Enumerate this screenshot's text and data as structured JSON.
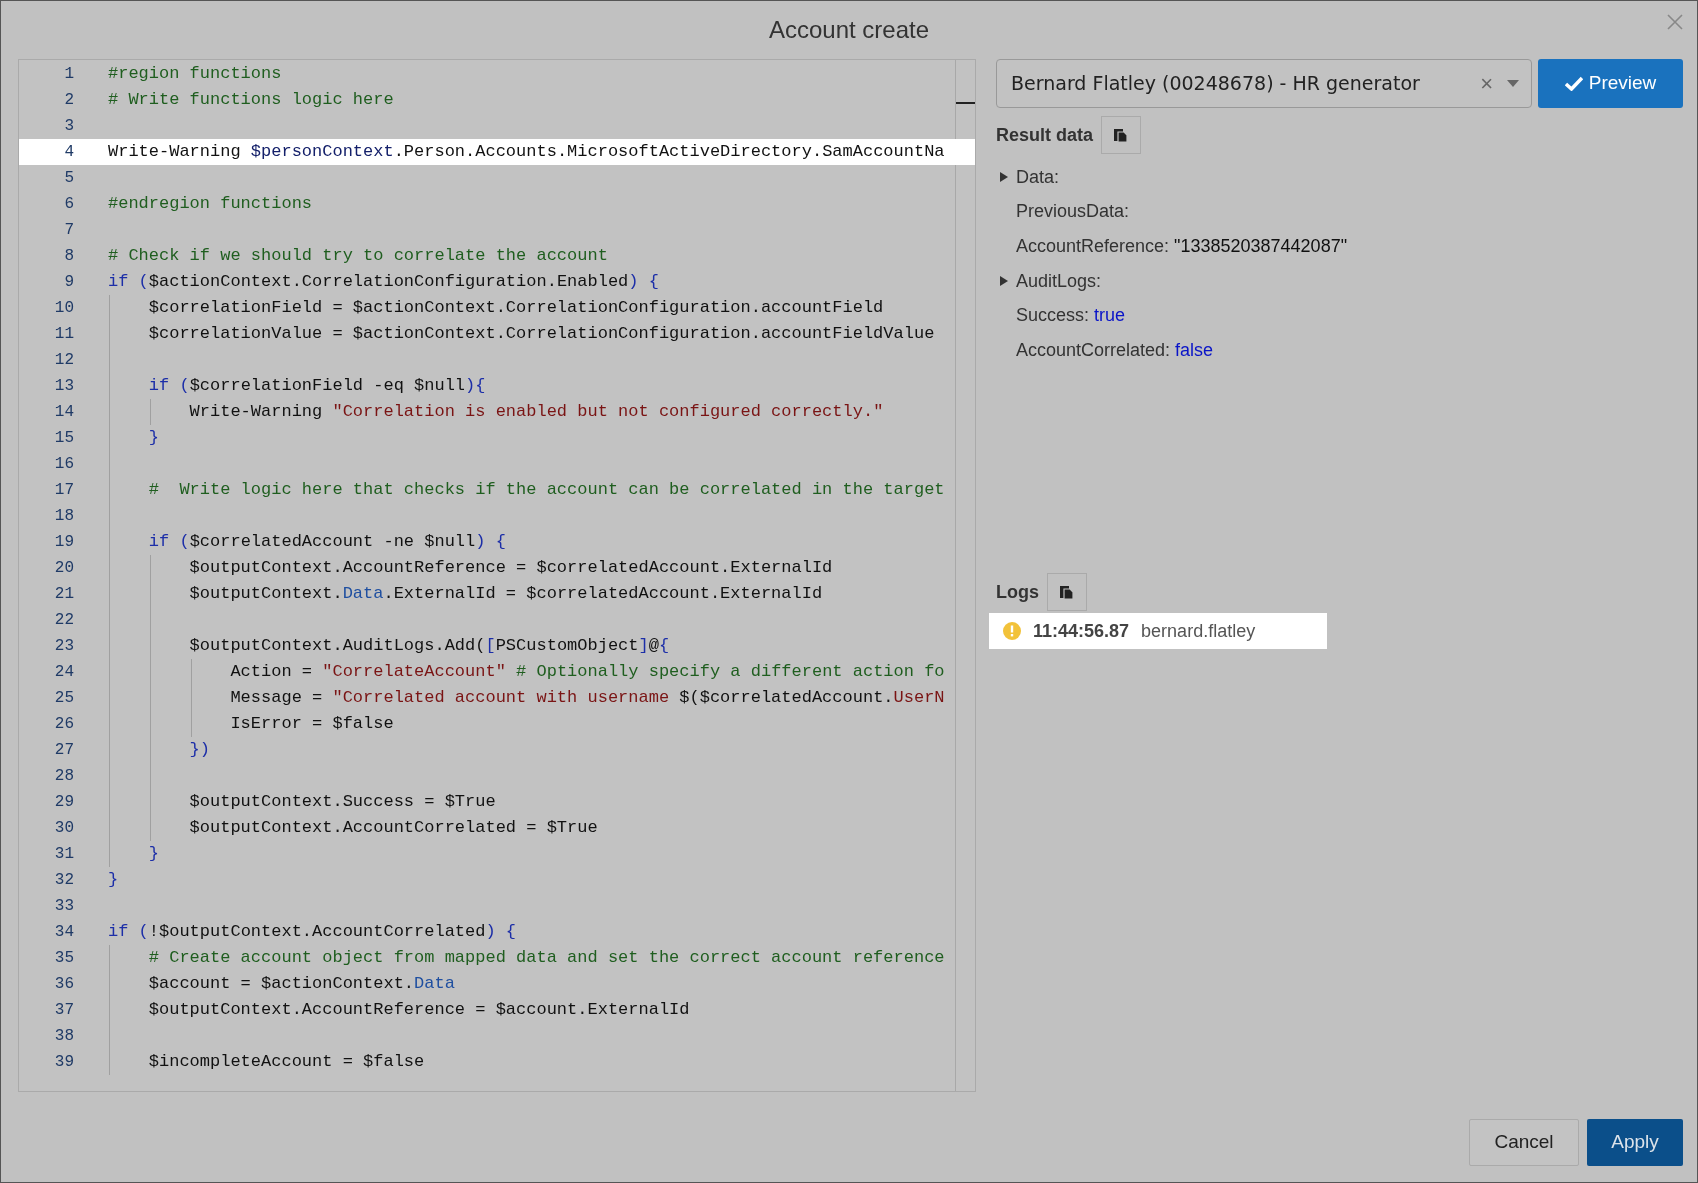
{
  "dialog": {
    "title": "Account create"
  },
  "editor": {
    "lines": [
      {
        "number": "1",
        "tokens": [
          {
            "kind": "comment",
            "text": "#region functions"
          }
        ]
      },
      {
        "number": "2",
        "tokens": [
          {
            "kind": "comment",
            "text": "# Write functions logic here"
          }
        ]
      },
      {
        "number": "3"
      },
      {
        "number": "4",
        "highlighted": true,
        "tokens": [
          {
            "kind": "plain",
            "text": "Write-Warning "
          },
          {
            "kind": "variable",
            "text": "$personContext"
          },
          {
            "kind": "plain",
            "text": ".Person.Accounts.MicrosoftActiveDirectory.SamAccountNa"
          }
        ]
      },
      {
        "number": "5"
      },
      {
        "number": "6",
        "tokens": [
          {
            "kind": "comment",
            "text": "#endregion functions"
          }
        ]
      },
      {
        "number": "7"
      },
      {
        "number": "8",
        "tokens": [
          {
            "kind": "comment",
            "text": "# Check if we should try to correlate the account"
          }
        ]
      },
      {
        "number": "9",
        "tokens": [
          {
            "kind": "keyword",
            "text": "if ("
          },
          {
            "kind": "plain",
            "text": "$actionContext.CorrelationConfiguration.Enabled"
          },
          {
            "kind": "keyword",
            "text": ") {"
          }
        ]
      },
      {
        "number": "10",
        "tokens": [
          {
            "kind": "plain",
            "text": "    $correlationField = $actionContext.CorrelationConfiguration.accountField"
          }
        ]
      },
      {
        "number": "11",
        "tokens": [
          {
            "kind": "plain",
            "text": "    $correlationValue = $actionContext.CorrelationConfiguration.accountFieldValue"
          }
        ]
      },
      {
        "number": "12"
      },
      {
        "number": "13",
        "tokens": [
          {
            "kind": "keyword",
            "text": "    if ("
          },
          {
            "kind": "plain",
            "text": "$correlationField -eq $null"
          },
          {
            "kind": "keyword",
            "text": "){"
          }
        ]
      },
      {
        "number": "14",
        "tokens": [
          {
            "kind": "plain",
            "text": "        Write-Warning "
          },
          {
            "kind": "string",
            "text": "\"Correlation is enabled but not configured correctly.\""
          }
        ]
      },
      {
        "number": "15",
        "tokens": [
          {
            "kind": "keyword",
            "text": "    }"
          }
        ]
      },
      {
        "number": "16"
      },
      {
        "number": "17",
        "tokens": [
          {
            "kind": "comment",
            "text": "    #  Write logic here that checks if the account can be correlated in the target"
          }
        ]
      },
      {
        "number": "18"
      },
      {
        "number": "19",
        "tokens": [
          {
            "kind": "keyword",
            "text": "    if ("
          },
          {
            "kind": "plain",
            "text": "$correlatedAccount -ne $null"
          },
          {
            "kind": "keyword",
            "text": ") {"
          }
        ]
      },
      {
        "number": "20",
        "tokens": [
          {
            "kind": "plain",
            "text": "        $outputContext.AccountReference = $correlatedAccount.ExternalId"
          }
        ]
      },
      {
        "number": "21",
        "tokens": [
          {
            "kind": "plain",
            "text": "        $outputContext."
          },
          {
            "kind": "type",
            "text": "Data"
          },
          {
            "kind": "plain",
            "text": ".ExternalId = $correlatedAccount.ExternalId"
          }
        ]
      },
      {
        "number": "22"
      },
      {
        "number": "23",
        "tokens": [
          {
            "kind": "plain",
            "text": "        $outputContext.AuditLogs.Add("
          },
          {
            "kind": "keyword",
            "text": "["
          },
          {
            "kind": "plain",
            "text": "PSCustomObject"
          },
          {
            "kind": "keyword",
            "text": "]"
          },
          {
            "kind": "plain",
            "text": "@"
          },
          {
            "kind": "keyword",
            "text": "{"
          }
        ]
      },
      {
        "number": "24",
        "tokens": [
          {
            "kind": "plain",
            "text": "            Action = "
          },
          {
            "kind": "string",
            "text": "\"CorrelateAccount\""
          },
          {
            "kind": "comment",
            "text": " # Optionally specify a different action fo"
          }
        ]
      },
      {
        "number": "25",
        "tokens": [
          {
            "kind": "plain",
            "text": "            Message = "
          },
          {
            "kind": "string",
            "text": "\"Correlated account with username "
          },
          {
            "kind": "plain",
            "text": "$($correlatedAccount."
          },
          {
            "kind": "string",
            "text": "UserN"
          }
        ]
      },
      {
        "number": "26",
        "tokens": [
          {
            "kind": "plain",
            "text": "            IsError = $false"
          }
        ]
      },
      {
        "number": "27",
        "tokens": [
          {
            "kind": "keyword",
            "text": "        })"
          }
        ]
      },
      {
        "number": "28"
      },
      {
        "number": "29",
        "tokens": [
          {
            "kind": "plain",
            "text": "        $outputContext.Success = $True"
          }
        ]
      },
      {
        "number": "30",
        "tokens": [
          {
            "kind": "plain",
            "text": "        $outputContext.AccountCorrelated = $True"
          }
        ]
      },
      {
        "number": "31",
        "tokens": [
          {
            "kind": "keyword",
            "text": "    }"
          }
        ]
      },
      {
        "number": "32",
        "tokens": [
          {
            "kind": "keyword",
            "text": "}"
          }
        ]
      },
      {
        "number": "33"
      },
      {
        "number": "34",
        "tokens": [
          {
            "kind": "keyword",
            "text": "if ("
          },
          {
            "kind": "plain",
            "text": "!$outputContext.AccountCorrelated"
          },
          {
            "kind": "keyword",
            "text": ") {"
          }
        ]
      },
      {
        "number": "35",
        "tokens": [
          {
            "kind": "comment",
            "text": "    # Create account object from mapped data and set the correct account reference"
          }
        ]
      },
      {
        "number": "36",
        "tokens": [
          {
            "kind": "plain",
            "text": "    $account = $actionContext."
          },
          {
            "kind": "type",
            "text": "Data"
          }
        ]
      },
      {
        "number": "37",
        "tokens": [
          {
            "kind": "plain",
            "text": "    $outputContext.AccountReference = $account.ExternalId"
          }
        ]
      },
      {
        "number": "38"
      },
      {
        "number": "39",
        "tokens": [
          {
            "kind": "plain",
            "text": "    $incompleteAccount = $false"
          }
        ]
      }
    ]
  },
  "person_select": {
    "value": "Bernard Flatley (00248678) - HR generator",
    "clear": "×"
  },
  "preview_button": {
    "label": "Preview"
  },
  "result_data": {
    "heading": "Result data",
    "items": [
      {
        "key": "Data:",
        "expandable": true,
        "expanded": false
      },
      {
        "key": "PreviousData:",
        "expandable": false
      },
      {
        "key": "AccountReference:",
        "value": "\"1338520387442087\"",
        "kind": "string",
        "expandable": false
      },
      {
        "key": "AuditLogs:",
        "expandable": true,
        "expanded": false
      },
      {
        "key": "Success:",
        "value": "true",
        "kind": "bool",
        "expandable": false
      },
      {
        "key": "AccountCorrelated:",
        "value": "false",
        "kind": "bool",
        "expandable": false
      }
    ]
  },
  "logs": {
    "heading": "Logs",
    "entries": [
      {
        "kind": "warning",
        "time": "11:44:56.87",
        "user": "bernard.flatley"
      }
    ]
  },
  "buttons": [
    {
      "label": "Cancel",
      "kind": "secondary"
    },
    {
      "label": "Apply",
      "kind": "primary"
    }
  ]
}
